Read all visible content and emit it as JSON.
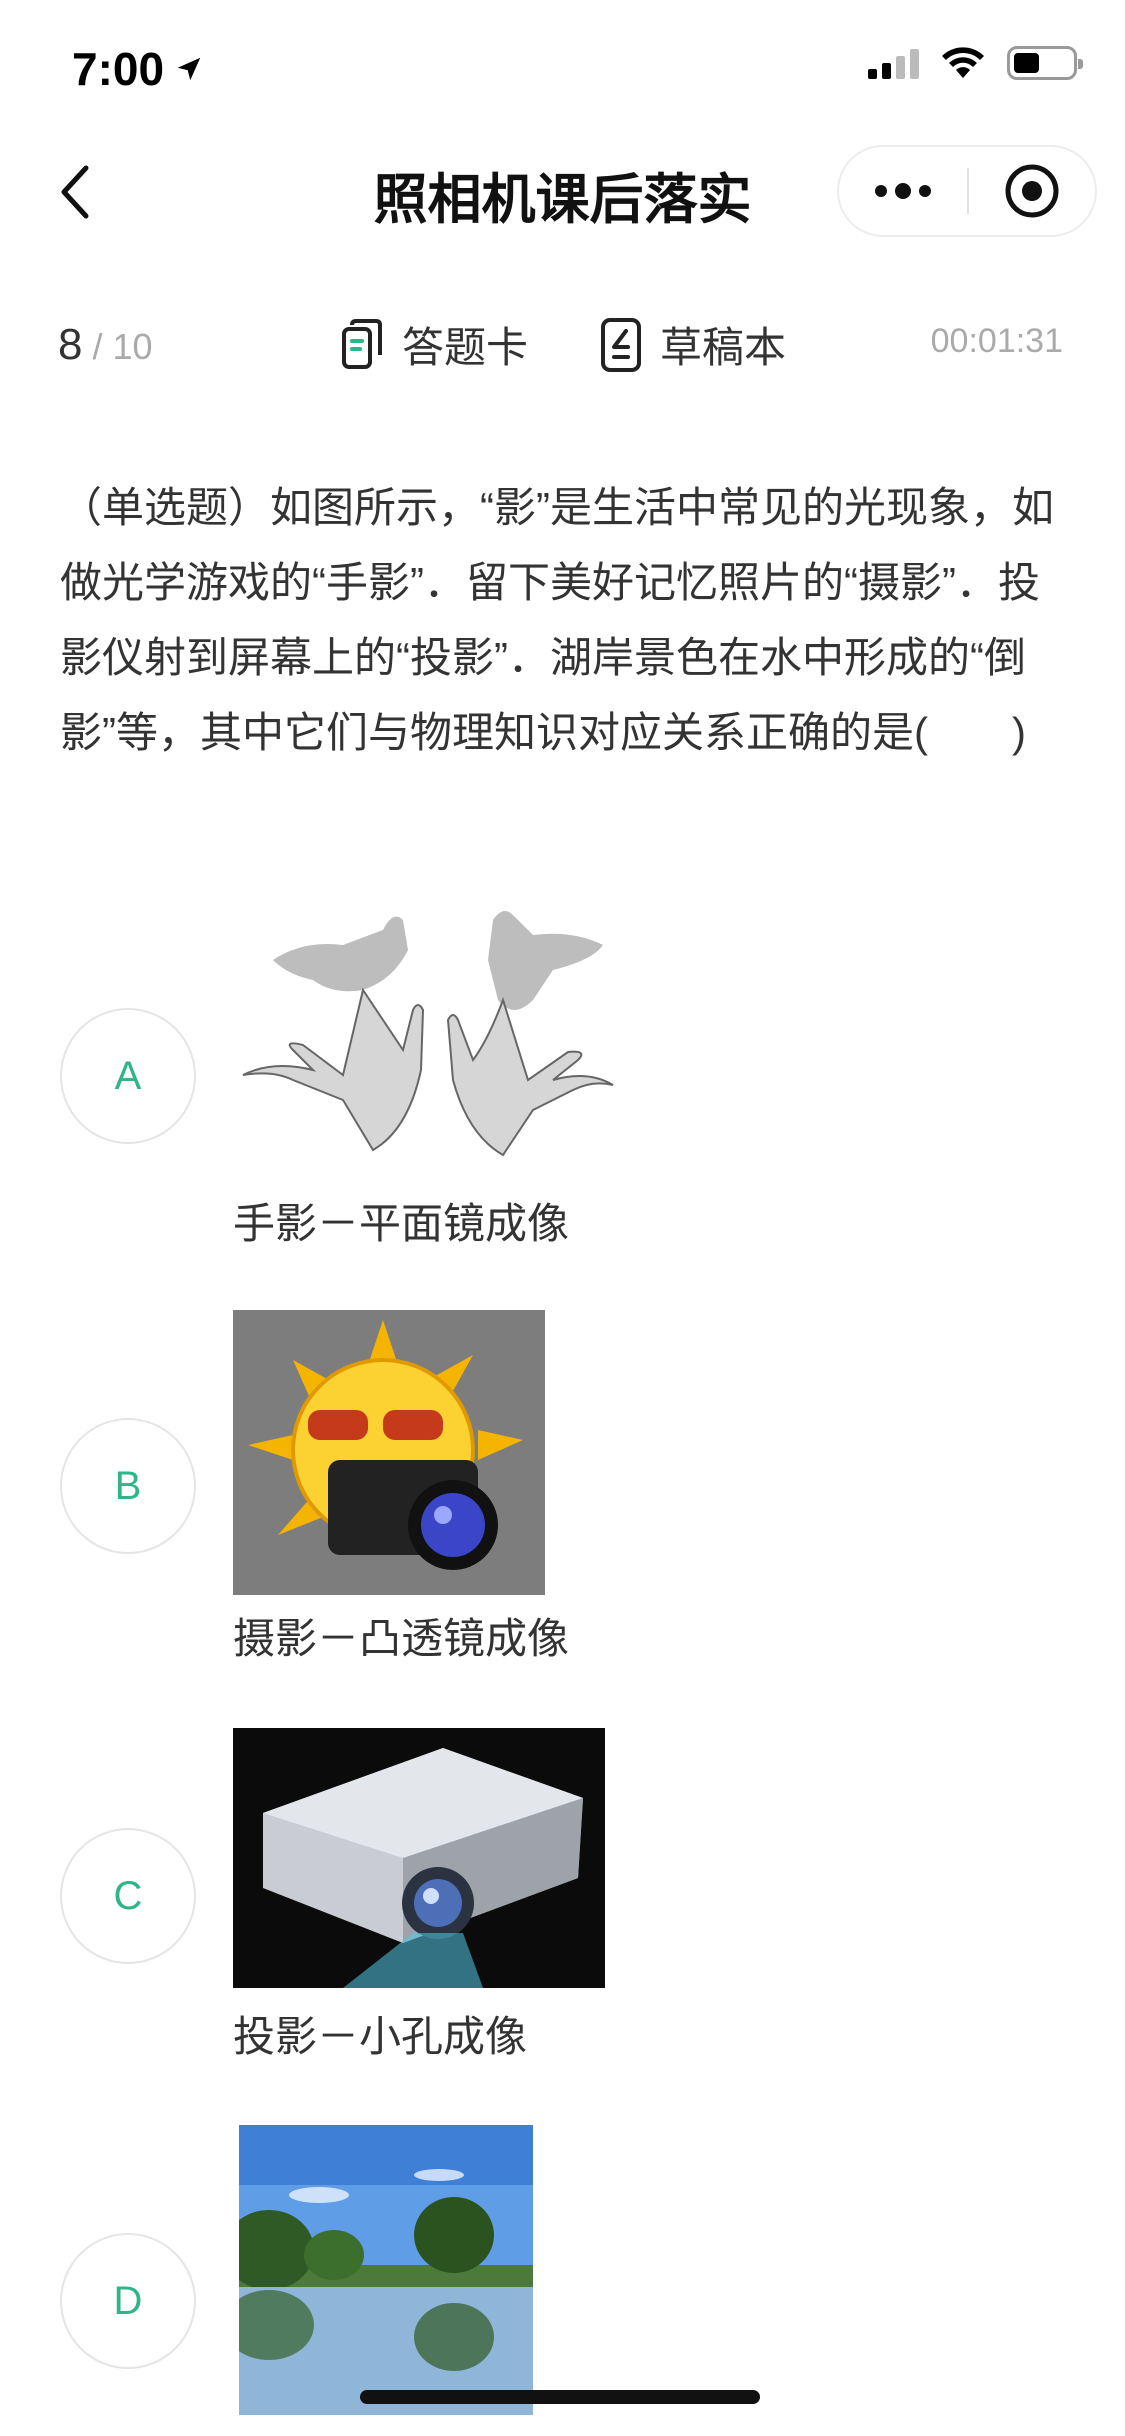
{
  "status_bar": {
    "time": "7:00",
    "location_icon": "location-arrow-icon",
    "signal_icon": "signal-icon",
    "wifi_icon": "wifi-icon",
    "battery_icon": "battery-icon",
    "battery_level": 0.44
  },
  "nav": {
    "title": "照相机课后落实",
    "back_icon": "chevron-left-icon",
    "more_icon": "more-dots-icon",
    "close_icon": "target-circle-icon"
  },
  "toolbar": {
    "current": "8",
    "separator": "/",
    "total": "10",
    "answer_card_label": "答题卡",
    "answer_card_icon": "answer-card-icon",
    "draft_label": "草稿本",
    "draft_icon": "draft-pad-icon",
    "timer": "00:01:31"
  },
  "question": {
    "text": "（单选题）如图所示，“影”是生活中常见的光现象，如做光学游戏的“手影”．留下美好记忆照片的“摄影”．投影仪射到屏幕上的“投影”．湖岸景色在水中形成的“倒影”等，其中它们与物理知识对应关系正确的是(　　)"
  },
  "options": [
    {
      "letter": "A",
      "caption": "手影－平面镜成像",
      "image": "hand-shadow-illustration"
    },
    {
      "letter": "B",
      "caption": "摄影－凸透镜成像",
      "image": "sun-with-camera-illustration"
    },
    {
      "letter": "C",
      "caption": "投影－小孔成像",
      "image": "projector-photo"
    },
    {
      "letter": "D",
      "caption": "",
      "image": "lake-reflection-photo"
    }
  ],
  "colors": {
    "accent_green": "#2fb58a",
    "text": "#333333",
    "muted": "#aaaaaa"
  }
}
